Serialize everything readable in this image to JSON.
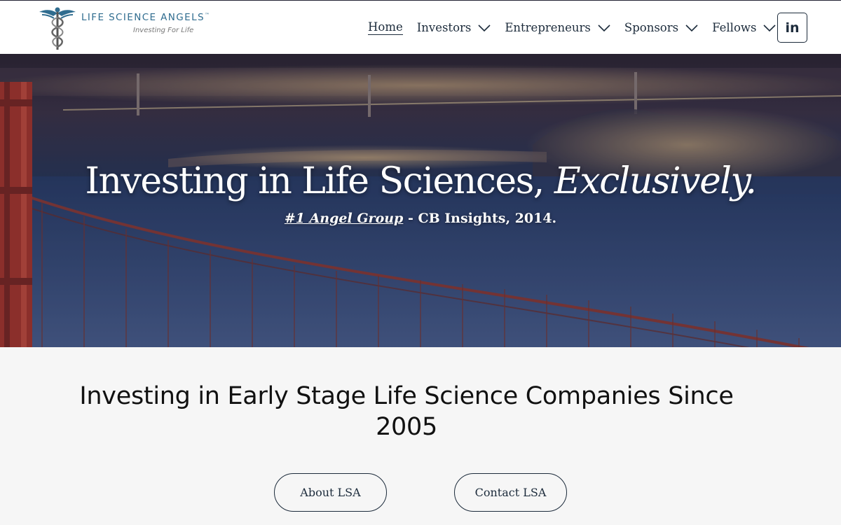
{
  "logo": {
    "name": "LIFE SCIENCE ANGELS",
    "trademark": "™",
    "tagline": "Investing For Life"
  },
  "nav": {
    "items": [
      {
        "label": "Home",
        "active": true,
        "has_dropdown": false
      },
      {
        "label": "Investors",
        "active": false,
        "has_dropdown": true
      },
      {
        "label": "Entrepreneurs",
        "active": false,
        "has_dropdown": true
      },
      {
        "label": "Sponsors",
        "active": false,
        "has_dropdown": true
      },
      {
        "label": "Fellows",
        "active": false,
        "has_dropdown": true
      }
    ],
    "linkedin_label": "in"
  },
  "hero": {
    "title_main": "Investing in Life Sciences, ",
    "title_emphasis": "Exclusively.",
    "subtitle_link": "#1 Angel Group",
    "subtitle_rest": " - CB Insights, 2014."
  },
  "main": {
    "tagline": "Investing in Early Stage Life Science Companies Since 2005",
    "about_button": "About LSA",
    "contact_button": "Contact LSA"
  },
  "colors": {
    "navy": "#1c2b3b",
    "logo_blue": "#2f6c8f",
    "bridge_red": "#a8352a",
    "page_bg": "#f6f6f6"
  }
}
